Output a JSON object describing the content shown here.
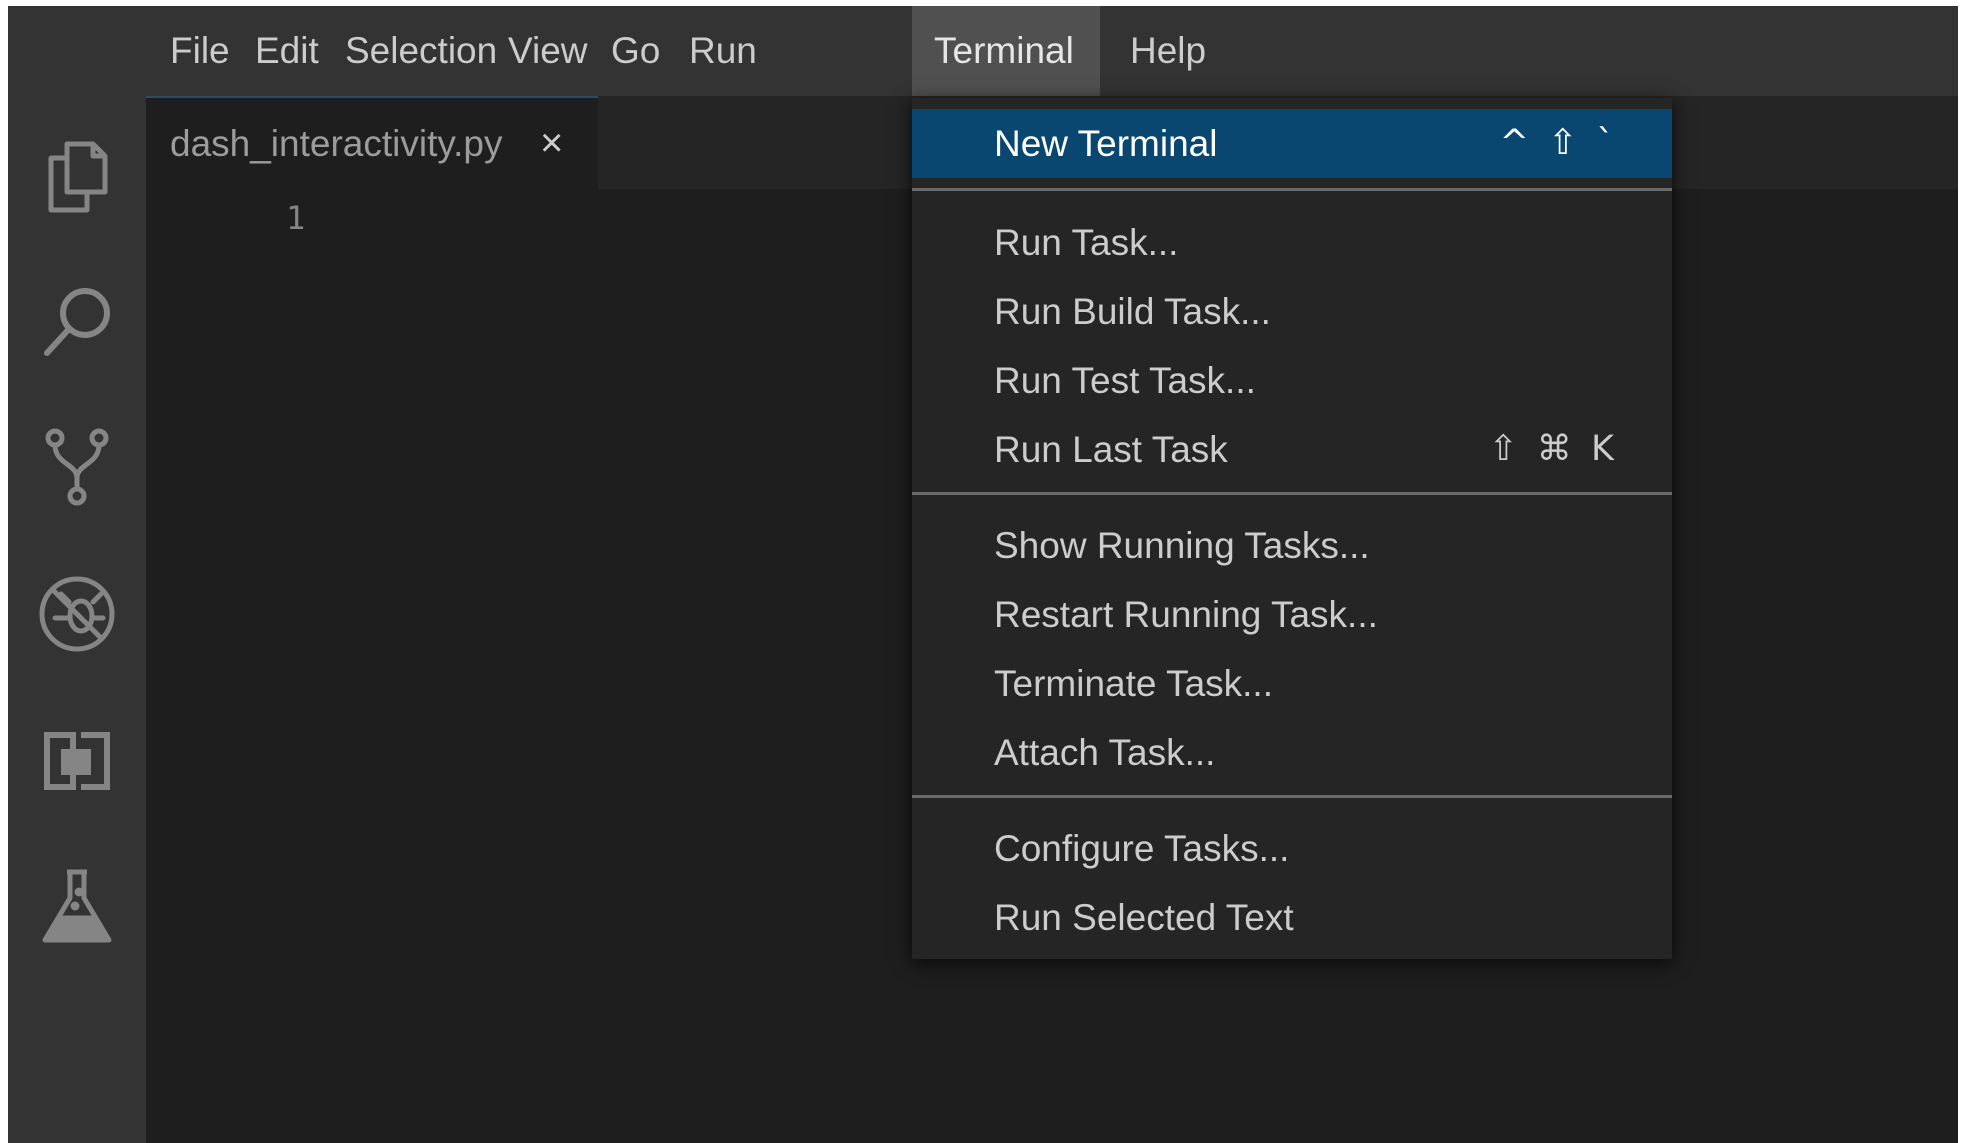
{
  "menubar": {
    "items": [
      {
        "label": "File"
      },
      {
        "label": "Edit"
      },
      {
        "label": "Selection"
      },
      {
        "label": "View"
      },
      {
        "label": "Go"
      },
      {
        "label": "Run"
      },
      {
        "label": "Terminal",
        "active": true
      },
      {
        "label": "Help"
      }
    ]
  },
  "activitybar": {
    "icons": [
      "explorer-icon",
      "search-icon",
      "source-control-icon",
      "debug-icon",
      "extensions-icon",
      "testing-icon"
    ]
  },
  "tabs": [
    {
      "label": "dash_interactivity.py",
      "close_glyph": "×"
    }
  ],
  "editor": {
    "line_numbers": [
      "1"
    ]
  },
  "terminal_menu": {
    "items": [
      {
        "label": "New Terminal",
        "shortcut": "^ ⇧ `",
        "highlighted": true
      },
      {
        "label": "Run Task...",
        "shortcut": ""
      },
      {
        "label": "Run Build Task...",
        "shortcut": ""
      },
      {
        "label": "Run Test Task...",
        "shortcut": ""
      },
      {
        "label": "Run Last Task",
        "shortcut": "⇧ ⌘ K"
      },
      {
        "label": "Show Running Tasks...",
        "shortcut": ""
      },
      {
        "label": "Restart Running Task...",
        "shortcut": ""
      },
      {
        "label": "Terminate Task...",
        "shortcut": ""
      },
      {
        "label": "Attach Task...",
        "shortcut": ""
      },
      {
        "label": "Configure Tasks...",
        "shortcut": ""
      },
      {
        "label": "Run Selected Text",
        "shortcut": ""
      }
    ]
  },
  "colors": {
    "menubar_bg": "#333333",
    "editor_bg": "#1e1e1e",
    "menu_highlight": "#094771",
    "text": "#cccccc"
  }
}
